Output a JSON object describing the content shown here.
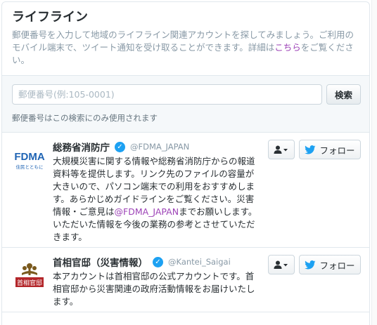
{
  "module": {
    "title": "ライフライン",
    "description_main": "郵便番号を入力して地域のライフライン関連アカウントを探してみましょう。ご利用のモバイル端末で、ツイート通知を受け取ることができます。詳細は",
    "description_link": "こちら",
    "description_tail": "をご覧ください。"
  },
  "search": {
    "placeholder": "郵便番号(例:105-0001)",
    "button_label": "検索",
    "note": "郵便番号はこの検索にのみ使用されます"
  },
  "accounts": [
    {
      "name": "総務省消防庁",
      "screen_name": "@FDMA_JAPAN",
      "bio_before": "大規模災害に関する情報や総務省消防庁からの報道資料等を提供します。リンク先のファイルの容量が大きいので、パソコン端末での利用をおすすめします。あらかじめガイドラインをご覧ください。災害情報・ご意見は",
      "bio_mention": "@FDMA_JAPAN",
      "bio_after": "までお願いします。いただいた情報を今後の業務の参考とさせていただきます。",
      "avatar_text": "FDMA",
      "avatar_subtext": "住民とともに",
      "follow_label": "フォロー"
    },
    {
      "name": "首相官邸（災害情報）",
      "screen_name": "@Kantei_Saigai",
      "bio": "本アカウントは首相官邸の公式アカウントです。首相官邸から災害関連の政府活動情報をお届けいたします。",
      "avatar_text": "首相官邸",
      "follow_label": "フォロー"
    }
  ],
  "icons": {
    "verified": "verified-badge-icon",
    "user": "user-dropdown-icon",
    "bird": "twitter-bird-icon"
  },
  "colors": {
    "accent": "#1da1f2",
    "link": "#9d43b7",
    "kantei_red": "#b3262a"
  }
}
